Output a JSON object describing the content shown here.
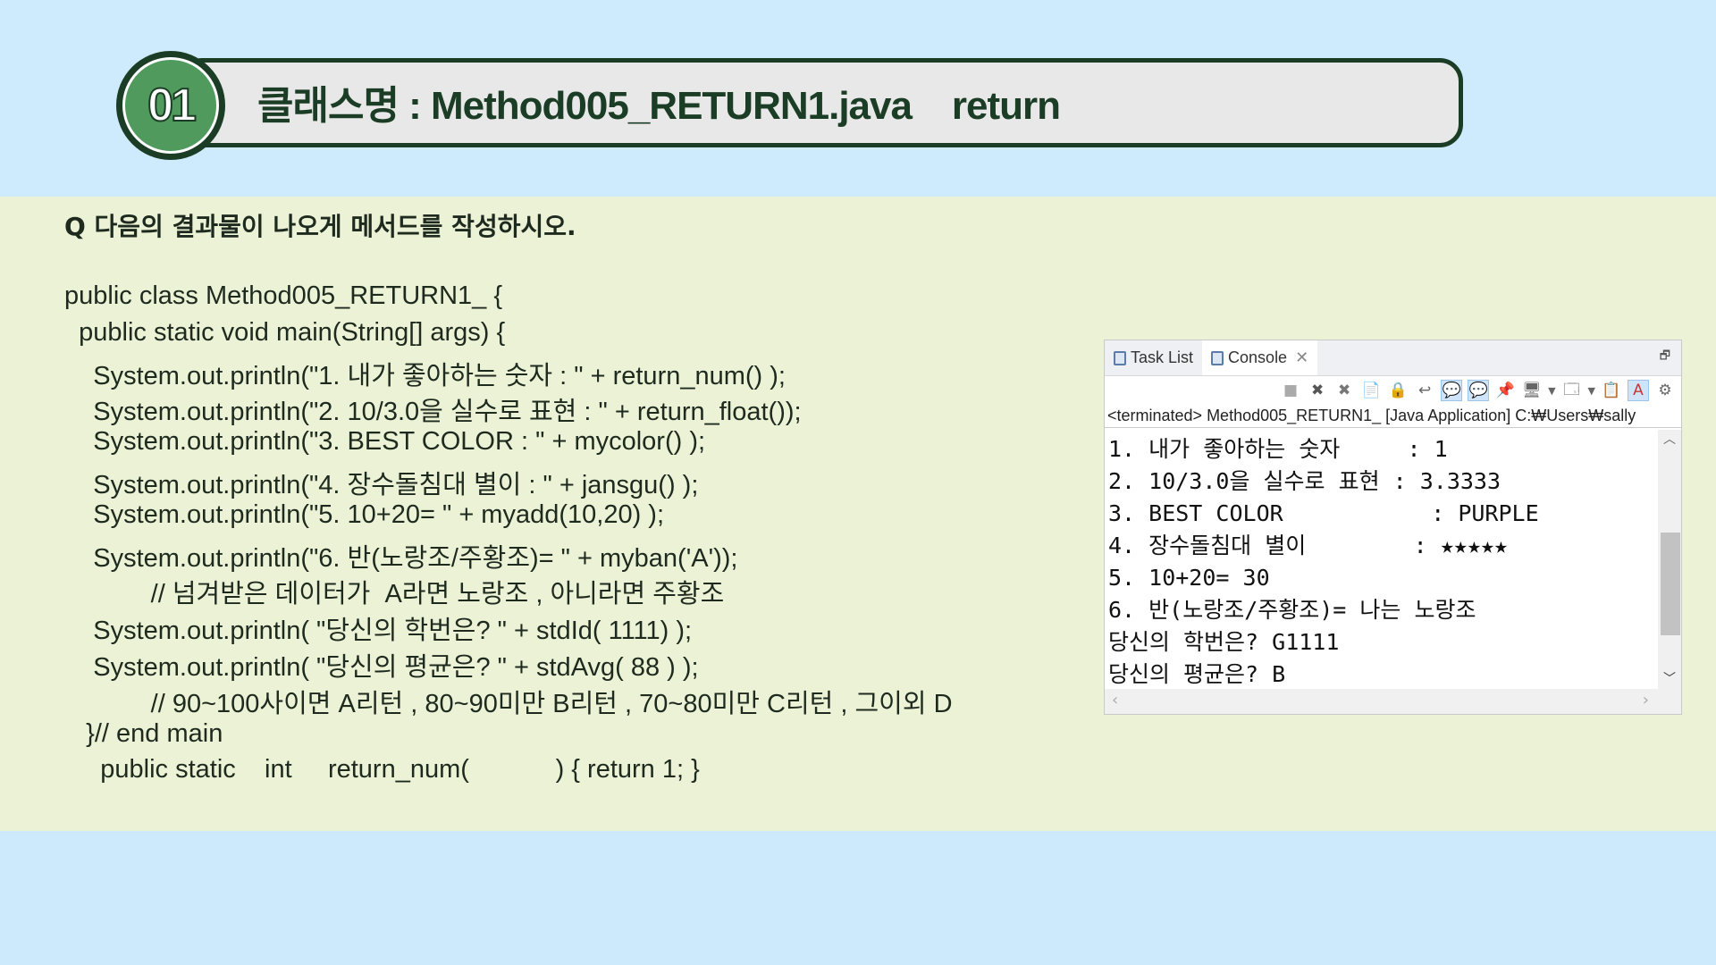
{
  "header": {
    "number": "01",
    "title": "클래스명 : Method005_RETURN1.java    return"
  },
  "question": "Q 다음의 결과물이 나오게 메서드를 작성하시오.",
  "code_lines": [
    "public class Method005_RETURN1_ {",
    "  public static void main(String[] args) {",
    "    System.out.println(\"1. 내가 좋아하는 숫자 : \" + return_num() );",
    "    System.out.println(\"2. 10/3.0을 실수로 표현 : \" + return_float());",
    "    System.out.println(\"3. BEST COLOR : \" + mycolor() );",
    "    System.out.println(\"4. 장수돌침대 별이 : \" + jansgu() );",
    "    System.out.println(\"5. 10+20= \" + myadd(10,20) );",
    "    System.out.println(\"6. 반(노랑조/주황조)= \" + myban('A'));",
    "            // 넘겨받은 데이터가  A라면 노랑조 , 아니라면 주황조",
    "    System.out.println( \"당신의 학번은? \" + stdId( 1111) );",
    "    System.out.println( \"당신의 평균은? \" + stdAvg( 88 ) );",
    "            // 90~100사이면 A리턴 , 80~90미만 B리턴 , 70~80미만 C리턴 , 그이외 D",
    "   }// end main",
    "     public static    int     return_num(            ) { return 1; }"
  ],
  "console": {
    "tabs": [
      {
        "label": "Task List",
        "icon": "task-list-icon"
      },
      {
        "label": "Console",
        "icon": "console-icon"
      }
    ],
    "status": "<terminated> Method005_RETURN1_ [Java Application] C:₩Users₩sally",
    "output": [
      "1. 내가 좋아하는 숫자     : 1",
      "2. 10/3.0을 실수로 표현 : 3.3333",
      "3. BEST COLOR           : PURPLE",
      "4. 장수돌침대 별이        : ★★★★★",
      "5. 10+20= 30",
      "6. 반(노랑조/주황조)= 나는 노랑조",
      "당신의 학번은? G1111",
      "당신의 평균은? B"
    ]
  },
  "colors": {
    "header_bg": "#cdebfc",
    "band_bg": "#ebf2d6",
    "accent_green": "#1c3d25",
    "badge_green": "#4f9a5c"
  }
}
